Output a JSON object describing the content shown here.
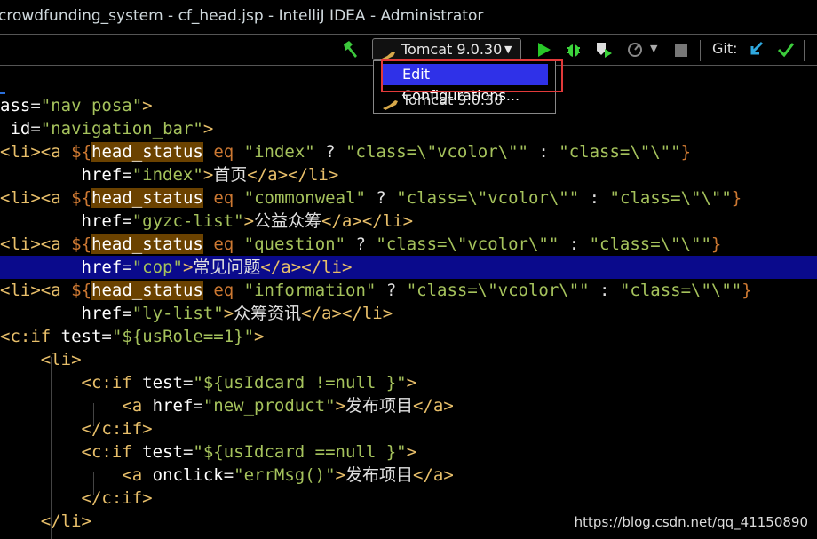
{
  "window": {
    "title": "crowdfunding_system - cf_head.jsp - IntelliJ IDEA - Administrator"
  },
  "toolbar": {
    "run_config_label": "Tomcat 9.0.30",
    "git_label": "Git:"
  },
  "run_menu": {
    "items": [
      "Edit Configurations...",
      "Tomcat 9.0.30"
    ]
  },
  "editor": {
    "lines": [
      "ass=\"nav posa\">",
      " id=\"navigation_bar\">",
      "<li><a ${head_status eq \"index\" ? \"class=\\\"vcolor\\\"\" : \"class=\\\"\\\"\"}",
      "        href=\"index\">首页</a></li>",
      "<li><a ${head_status eq \"commonweal\" ? \"class=\\\"vcolor\\\"\" : \"class=\\\"\\\"\"}",
      "        href=\"gyzc-list\">公益众筹</a></li>",
      "<li><a ${head_status eq \"question\" ? \"class=\\\"vcolor\\\"\" : \"class=\\\"\\\"\"}",
      "        href=\"cop\">常见问题</a></li>",
      "<li><a ${head_status eq \"information\" ? \"class=\\\"vcolor\\\"\" : \"class=\\\"\\\"\"}",
      "        href=\"ly-list\">众筹资讯</a></li>",
      "<c:if test=\"${usRole==1}\">",
      "    <li>",
      "        <c:if test=\"${usIdcard !=null }\">",
      "            <a href=\"new_product\">发布项目</a>",
      "        </c:if>",
      "        <c:if test=\"${usIdcard ==null }\">",
      "            <a onclick=\"errMsg()\">发布项目</a>",
      "        </c:if>",
      "    </li>"
    ]
  },
  "watermark": "https://blog.csdn.net/qq_41150890",
  "colors": {
    "menu_selected": "#2f31e8",
    "annotation_box": "#e23a3a",
    "highlighted_line": "#0a0a8c",
    "run_green": "#28c828",
    "debug_green": "#3cd43c",
    "git_update": "#2fa9e0",
    "git_commit": "#3ccc3c"
  },
  "icons": [
    "hammer-icon",
    "cat-icon",
    "chevron-down-icon",
    "run-icon",
    "debug-icon",
    "coverage-icon",
    "profile-icon",
    "stop-icon",
    "git-update-icon",
    "git-commit-icon"
  ]
}
